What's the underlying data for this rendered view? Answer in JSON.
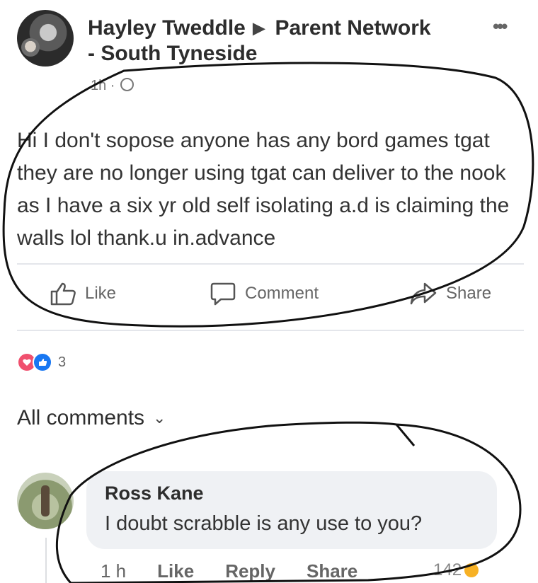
{
  "post": {
    "author": "Hayley Tweddle",
    "group_line1": "Parent Network",
    "group_line2": "- South Tyneside",
    "time": "1h",
    "text": "Hi I don't sopose anyone has any bord games tgat they are no longer using tgat can deliver to the nook as I have a six yr old self isolating a.d is claiming the walls lol  thank.u in.advance",
    "actions": {
      "like": "Like",
      "comment": "Comment",
      "share": "Share"
    },
    "reaction_count": "3"
  },
  "comments_filter": "All comments",
  "comment": {
    "author": "Ross Kane",
    "text": "I doubt scrabble is any use to you?",
    "time": "1 h",
    "like": "Like",
    "reply": "Reply",
    "share": "Share",
    "like_count": "142"
  },
  "icons": {
    "arrow": "▶",
    "more": "•••",
    "chevron": "⌄"
  },
  "colors": {
    "like_blue": "#1877f2",
    "love_red": "#f0506e",
    "bubble_bg": "#eff1f4",
    "annotation_ink": "#111111"
  }
}
